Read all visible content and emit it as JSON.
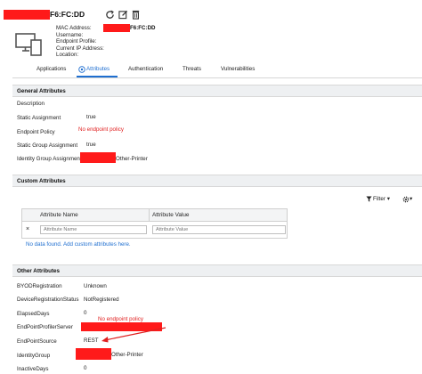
{
  "header": {
    "title_suffix": "F6:FC:DD"
  },
  "info": {
    "mac_label": "MAC Address:",
    "mac_value_suffix": "F6:FC:DD",
    "username_label": "Username:",
    "profile_label": "Endpoint Profile:",
    "ip_label": "Current IP Address:",
    "location_label": "Location:"
  },
  "tabs": [
    {
      "label": "Applications"
    },
    {
      "label": "Attributes"
    },
    {
      "label": "Authentication"
    },
    {
      "label": "Threats"
    },
    {
      "label": "Vulnerabilities"
    }
  ],
  "general": {
    "title": "General Attributes",
    "rows": [
      {
        "label": "Description",
        "value": ""
      },
      {
        "label": "Static Assignment",
        "value": "true"
      },
      {
        "label": "Endpoint Policy",
        "value": "No endpoint policy"
      },
      {
        "label": "Static Group Assignment",
        "value": "true"
      },
      {
        "label": "Identity Group Assignment",
        "value": "Other-Printer"
      }
    ]
  },
  "custom": {
    "title": "Custom Attributes",
    "filter_label": "Filter ▾",
    "gear_label": "▾",
    "col_name": "Attribute Name",
    "col_value": "Attribute Value",
    "name_placeholder": "Attribute Name",
    "value_placeholder": "Attribute Value",
    "empty_text": "No data found. Add custom attributes here."
  },
  "other": {
    "title": "Other Attributes",
    "rows": [
      {
        "label": "BYODRegistration",
        "value": "Unknown"
      },
      {
        "label": "DeviceRegistrationStatus",
        "value": "NotRegistered"
      },
      {
        "label": "ElapsedDays",
        "value": "0"
      },
      {
        "label": "EndPointProfilerServer",
        "value": ""
      },
      {
        "label": "EndPointSource",
        "value": "REST"
      },
      {
        "label": "IdentityGroup",
        "value": "Other-Printer"
      },
      {
        "label": "InactiveDays",
        "value": "0"
      }
    ],
    "annotation": "No endpoint policy"
  },
  "colors": {
    "accent": "#1f6fd0",
    "redaction": "#ff1a1a",
    "annotation": "#e02020"
  }
}
